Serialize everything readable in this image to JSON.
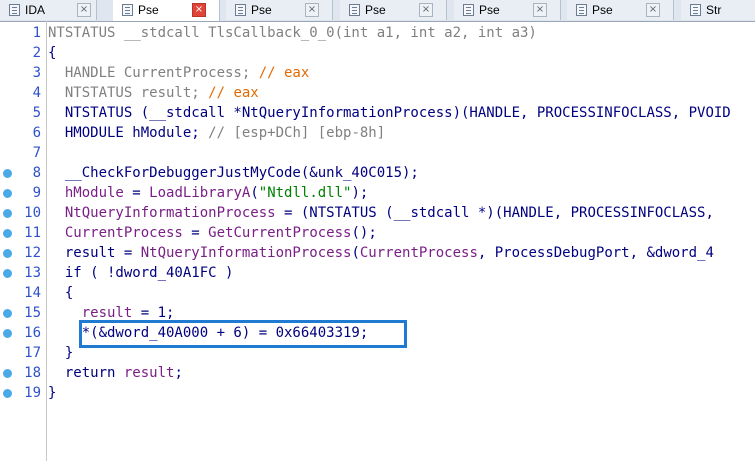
{
  "tabs": [
    {
      "label": "IDA",
      "active": false
    },
    {
      "label": "Pse",
      "active": true
    },
    {
      "label": "Pse",
      "active": false
    },
    {
      "label": "Pse",
      "active": false
    },
    {
      "label": "Pse",
      "active": false
    },
    {
      "label": "Pse",
      "active": false
    },
    {
      "label": "Str",
      "active": false
    }
  ],
  "close_glyph": "×",
  "code": {
    "ln1": "1",
    "ln2": "2",
    "ln3": "3",
    "ln4": "4",
    "ln5": "5",
    "ln6": "6",
    "ln7": "7",
    "ln8": "8",
    "ln9": "9",
    "ln10": "10",
    "ln11": "11",
    "ln12": "12",
    "ln13": "13",
    "ln14": "14",
    "ln15": "15",
    "ln16": "16",
    "ln17": "17",
    "ln18": "18",
    "ln19": "19",
    "l1": "NTSTATUS __stdcall TlsCallback_0_0(int a1, int a2, int a3)",
    "l2": "{",
    "l3_a": "  HANDLE CurrentProcess; ",
    "l3_b": "// eax",
    "l4_a": "  NTSTATUS result; ",
    "l4_b": "// eax",
    "l5": "  NTSTATUS (__stdcall *NtQueryInformationProcess)(HANDLE, PROCESSINFOCLASS, PVOID",
    "l6_a": "  HMODULE hModule; ",
    "l6_b": "// [esp+DCh] [ebp-8h]",
    "l7": "",
    "l8": "  __CheckForDebuggerJustMyCode(&unk_40C015);",
    "l9_a": "  ",
    "l9_b": "hModule",
    "l9_c": " = ",
    "l9_d": "LoadLibraryA",
    "l9_e": "(",
    "l9_f": "\"Ntdll.dll\"",
    "l9_g": ");",
    "l10_a": "  ",
    "l10_b": "NtQueryInformationProcess",
    "l10_c": " = (NTSTATUS (__stdcall *)(HANDLE, PROCESSINFOCLASS,",
    "l11_a": "  ",
    "l11_b": "CurrentProcess",
    "l11_c": " = ",
    "l11_d": "GetCurrentProcess",
    "l11_e": "();",
    "l12_a": "  result = ",
    "l12_b": "NtQueryInformationProcess",
    "l12_c": "(",
    "l12_d": "CurrentProcess",
    "l12_e": ", ProcessDebugPort, &dword_4",
    "l13": "  if ( !dword_40A1FC )",
    "l14": "  {",
    "l15_a": "    ",
    "l15_b": "result",
    "l15_c": " = 1;",
    "l16": "    *(&dword_40A000 + 6) = 0x66403319;",
    "l17": "  }",
    "l18_a": "  return ",
    "l18_b": "result",
    "l18_c": ";",
    "l19": "}"
  },
  "breakpoints_on_lines": [
    8,
    9,
    10,
    11,
    12,
    13,
    15,
    16,
    18,
    19
  ],
  "colors": {
    "accent_box": "#1f7bd1",
    "breakpoint": "#4aa9e8",
    "active_close": "#e0453a"
  }
}
